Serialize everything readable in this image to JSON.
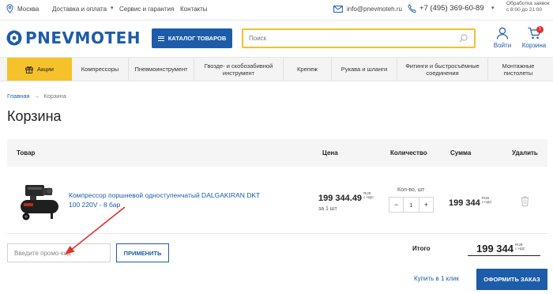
{
  "topbar": {
    "city": "Москва",
    "links": [
      "Доставка и оплата",
      "Сервис и гарантия",
      "Контакты"
    ],
    "email": "info@pnevmoteh.ru",
    "phone": "+7 (495) 369-60-89",
    "schedule_line1": "Обработка заявок",
    "schedule_line2": "с 8:00 до 21:00"
  },
  "header": {
    "logo_text": "PNEVMOTEH",
    "catalog_label": "КАТАЛОГ ТОВАРОВ",
    "search_placeholder": "Поиск",
    "login_label": "Войти",
    "cart_label": "Корзина",
    "cart_count": "1"
  },
  "nav": {
    "items": [
      "Акции",
      "Компрессоры",
      "Пневмоинструмент",
      "Гвозде- и скобозабивной инструмент",
      "Крепеж",
      "Рукава и шланги",
      "Фитинги и быстросъёмные соединения",
      "Монтажные пистолеты"
    ]
  },
  "breadcrumb": {
    "home": "Главная",
    "separator": "→",
    "current": "Корзина"
  },
  "page_title": "Корзина",
  "table": {
    "headers": {
      "product": "Товар",
      "price": "Цена",
      "quantity": "Количество",
      "sum": "Сумма",
      "delete": "Удалить"
    },
    "rows": [
      {
        "name": "Компрессор поршневой одноступенчатый DALGAKIRAN DKT 100 220V - 8 бар",
        "price": "199 344.49",
        "per_unit": "за 1 шт",
        "qty_label": "Кол-во, шт",
        "qty": "1",
        "sum": "199 344"
      }
    ]
  },
  "currency": {
    "rub": "RUB",
    "vat": "с НДС"
  },
  "promo": {
    "placeholder": "Введите промо-код",
    "apply_label": "ПРИМЕНИТЬ"
  },
  "totals": {
    "label": "Итого",
    "value": "199 344"
  },
  "actions": {
    "one_click": "Купить в 1 клик",
    "checkout": "ОФОРМИТЬ ЗАКАЗ"
  },
  "colors": {
    "brand": "#1d5ca8",
    "accent": "#f6c22b",
    "annotation_arrow": "#e0312d",
    "badge": "#e0312d"
  }
}
